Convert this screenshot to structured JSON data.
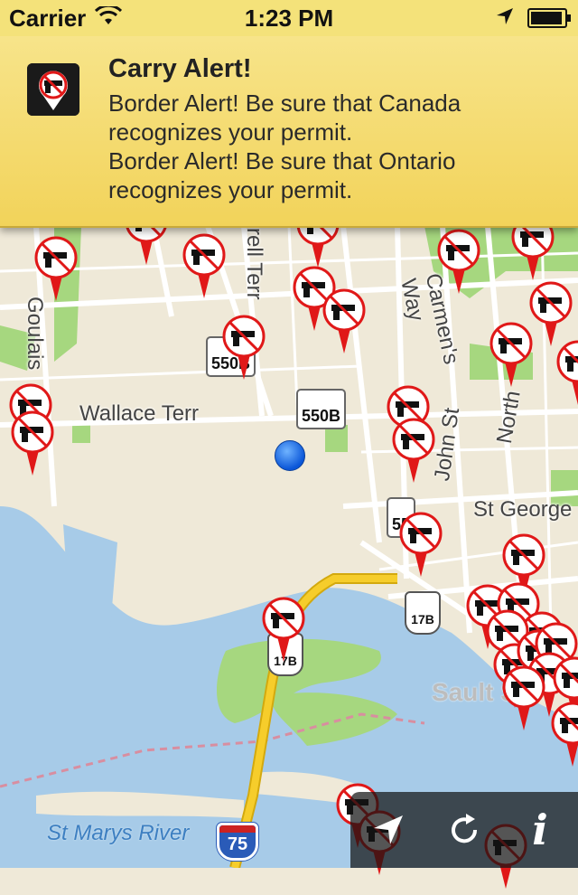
{
  "status_bar": {
    "carrier": "Carrier",
    "time": "1:23 PM",
    "battery_level": 0.95
  },
  "alert": {
    "title": "Carry Alert!",
    "messages": [
      "Border Alert! Be sure that Canada\nrecognizes your permit.",
      "Border Alert! Be sure that Ontario\nrecognizes your permit."
    ],
    "icon": "gun-restricted-icon"
  },
  "map": {
    "street_labels": {
      "wallace_terr": "Wallace Terr",
      "goulais": "Goulais",
      "rell_terr": "rell Terr",
      "carmens_way": "Carmen's Way",
      "john_st": "John St",
      "north": "North",
      "st_george": "St George",
      "sault": "Sault Ste",
      "river": "St Marys River"
    },
    "route_shields": {
      "r550b_a": "550B",
      "r550b_b": "550B",
      "r55_partial": "55",
      "r17b_a": "17B",
      "r17b_b": "17B",
      "i75": "75"
    },
    "colors": {
      "water": "#a7cbe8",
      "land": "#efe9d8",
      "park": "#9fd17a",
      "highway": "#f3c624",
      "marker_red": "#e01818"
    }
  },
  "toolbar": {
    "locate_icon": "location-arrow-icon",
    "refresh_icon": "refresh-icon",
    "info_label": "i"
  }
}
